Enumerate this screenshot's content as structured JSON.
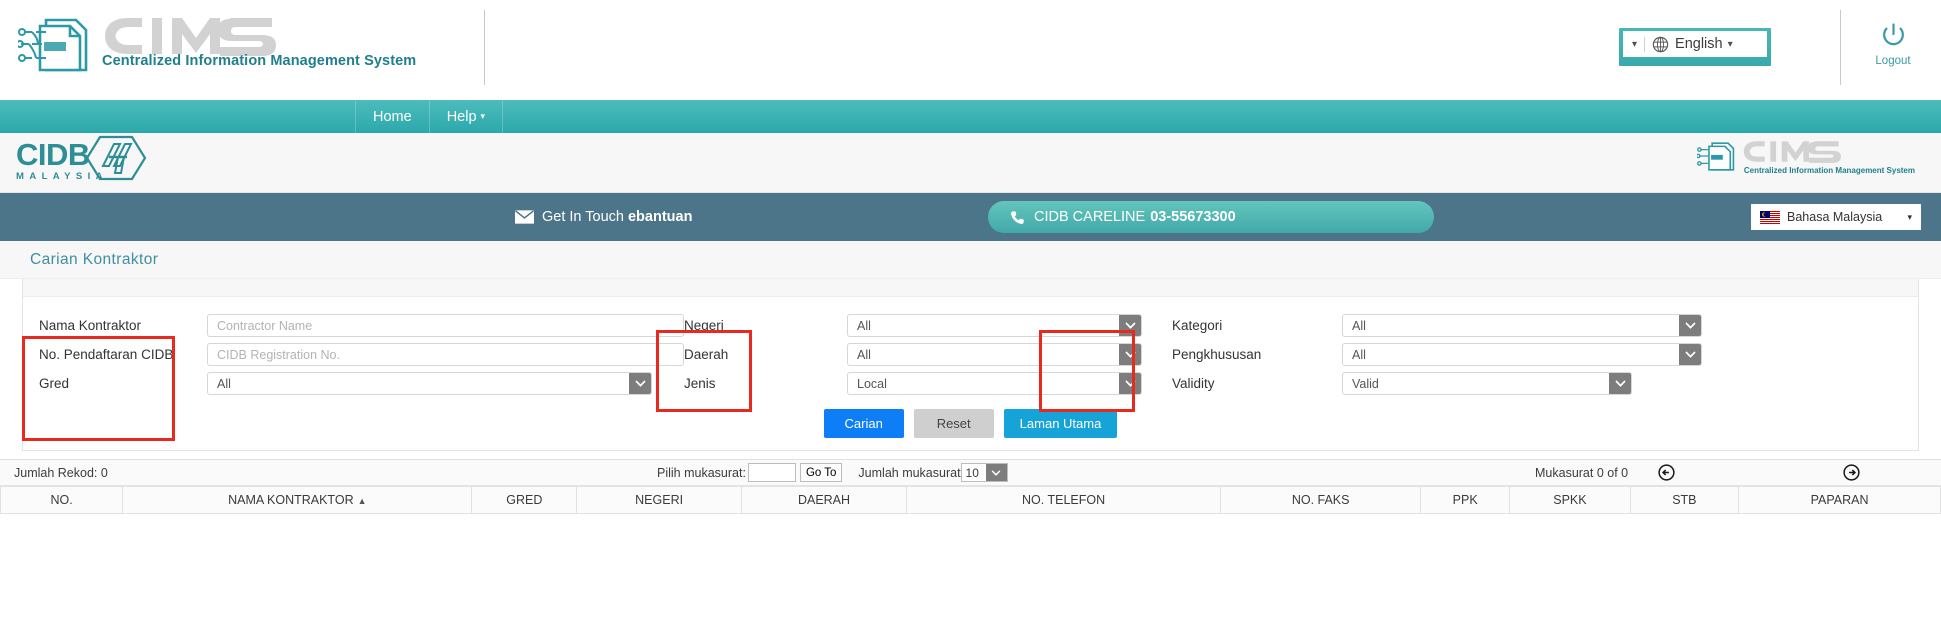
{
  "topbar": {
    "brand_name": "CIMS",
    "brand_tagline": "Centralized Information Management System",
    "language_widget": {
      "left_caret": "▾",
      "icon": "globe-icon",
      "label": "English",
      "caret": "▾"
    },
    "logout": {
      "label": "Logout",
      "icon": "power-icon"
    }
  },
  "nav": {
    "items": [
      {
        "label": "Home",
        "caret": ""
      },
      {
        "label": "Help",
        "caret": "▾"
      }
    ]
  },
  "brandbar": {
    "cidb_word": "CIDB",
    "cidb_sub": "MALAYSIA",
    "cims_name": "CIMS",
    "cims_tagline": "Centralized Information Management System"
  },
  "contactbar": {
    "get_in_touch_icon": "envelope-icon",
    "get_in_touch_text": "Get In Touch ",
    "get_in_touch_bold": "ebantuan",
    "careline_icon": "phone-icon",
    "careline_label": "CIDB CARELINE",
    "careline_number": "03-55673300",
    "language_flag": "malaysia-flag-icon",
    "language_label": "Bahasa Malaysia",
    "language_caret": "▾"
  },
  "page": {
    "title": "Carian Kontraktor"
  },
  "form": {
    "fields": {
      "nama_kontraktor": {
        "label": "Nama Kontraktor",
        "placeholder": "Contractor Name",
        "value": ""
      },
      "no_pendaftaran": {
        "label": "No. Pendaftaran CIDB",
        "placeholder": "CIDB Registration No.",
        "value": ""
      },
      "gred": {
        "label": "Gred",
        "value": "All"
      },
      "negeri": {
        "label": "Negeri",
        "value": "All"
      },
      "daerah": {
        "label": "Daerah",
        "value": "All"
      },
      "jenis": {
        "label": "Jenis",
        "value": "Local"
      },
      "kategori": {
        "label": "Kategori",
        "value": "All"
      },
      "pengkhususan": {
        "label": "Pengkhususan",
        "value": "All"
      },
      "validity": {
        "label": "Validity",
        "value": "Valid"
      }
    },
    "buttons": {
      "search": "Carian",
      "reset": "Reset",
      "home": "Laman Utama"
    },
    "highlight_color": "#e8291e"
  },
  "results": {
    "record_count_label": "Jumlah Rekod: 0",
    "page_select_label": "Pilih mukasurat:",
    "page_input_value": "",
    "goto_label": "Go To",
    "per_page_label": "Jumlah mukasurat",
    "per_page_value": "10",
    "page_indicator": "Mukasurat 0 of 0",
    "prev_icon": "arrow-circle-left-icon",
    "next_icon": "arrow-circle-right-icon",
    "columns": [
      {
        "label": "NO.",
        "sorted": ""
      },
      {
        "label": "NAMA KONTRAKTOR",
        "sorted": "▲"
      },
      {
        "label": "GRED",
        "sorted": ""
      },
      {
        "label": "NEGERI",
        "sorted": ""
      },
      {
        "label": "DAERAH",
        "sorted": ""
      },
      {
        "label": "NO. TELEFON",
        "sorted": ""
      },
      {
        "label": "NO. FAKS",
        "sorted": ""
      },
      {
        "label": "PPK",
        "sorted": ""
      },
      {
        "label": "SPKK",
        "sorted": ""
      },
      {
        "label": "STB",
        "sorted": ""
      },
      {
        "label": "PAPARAN",
        "sorted": ""
      }
    ],
    "rows": []
  },
  "colors": {
    "teal": "#2ca8ab",
    "slate": "#4d7589",
    "cidb": "#2d8e96",
    "primary_blue": "#0d7ef5",
    "home_blue": "#16a3d8",
    "highlight_red": "#e8291e"
  }
}
